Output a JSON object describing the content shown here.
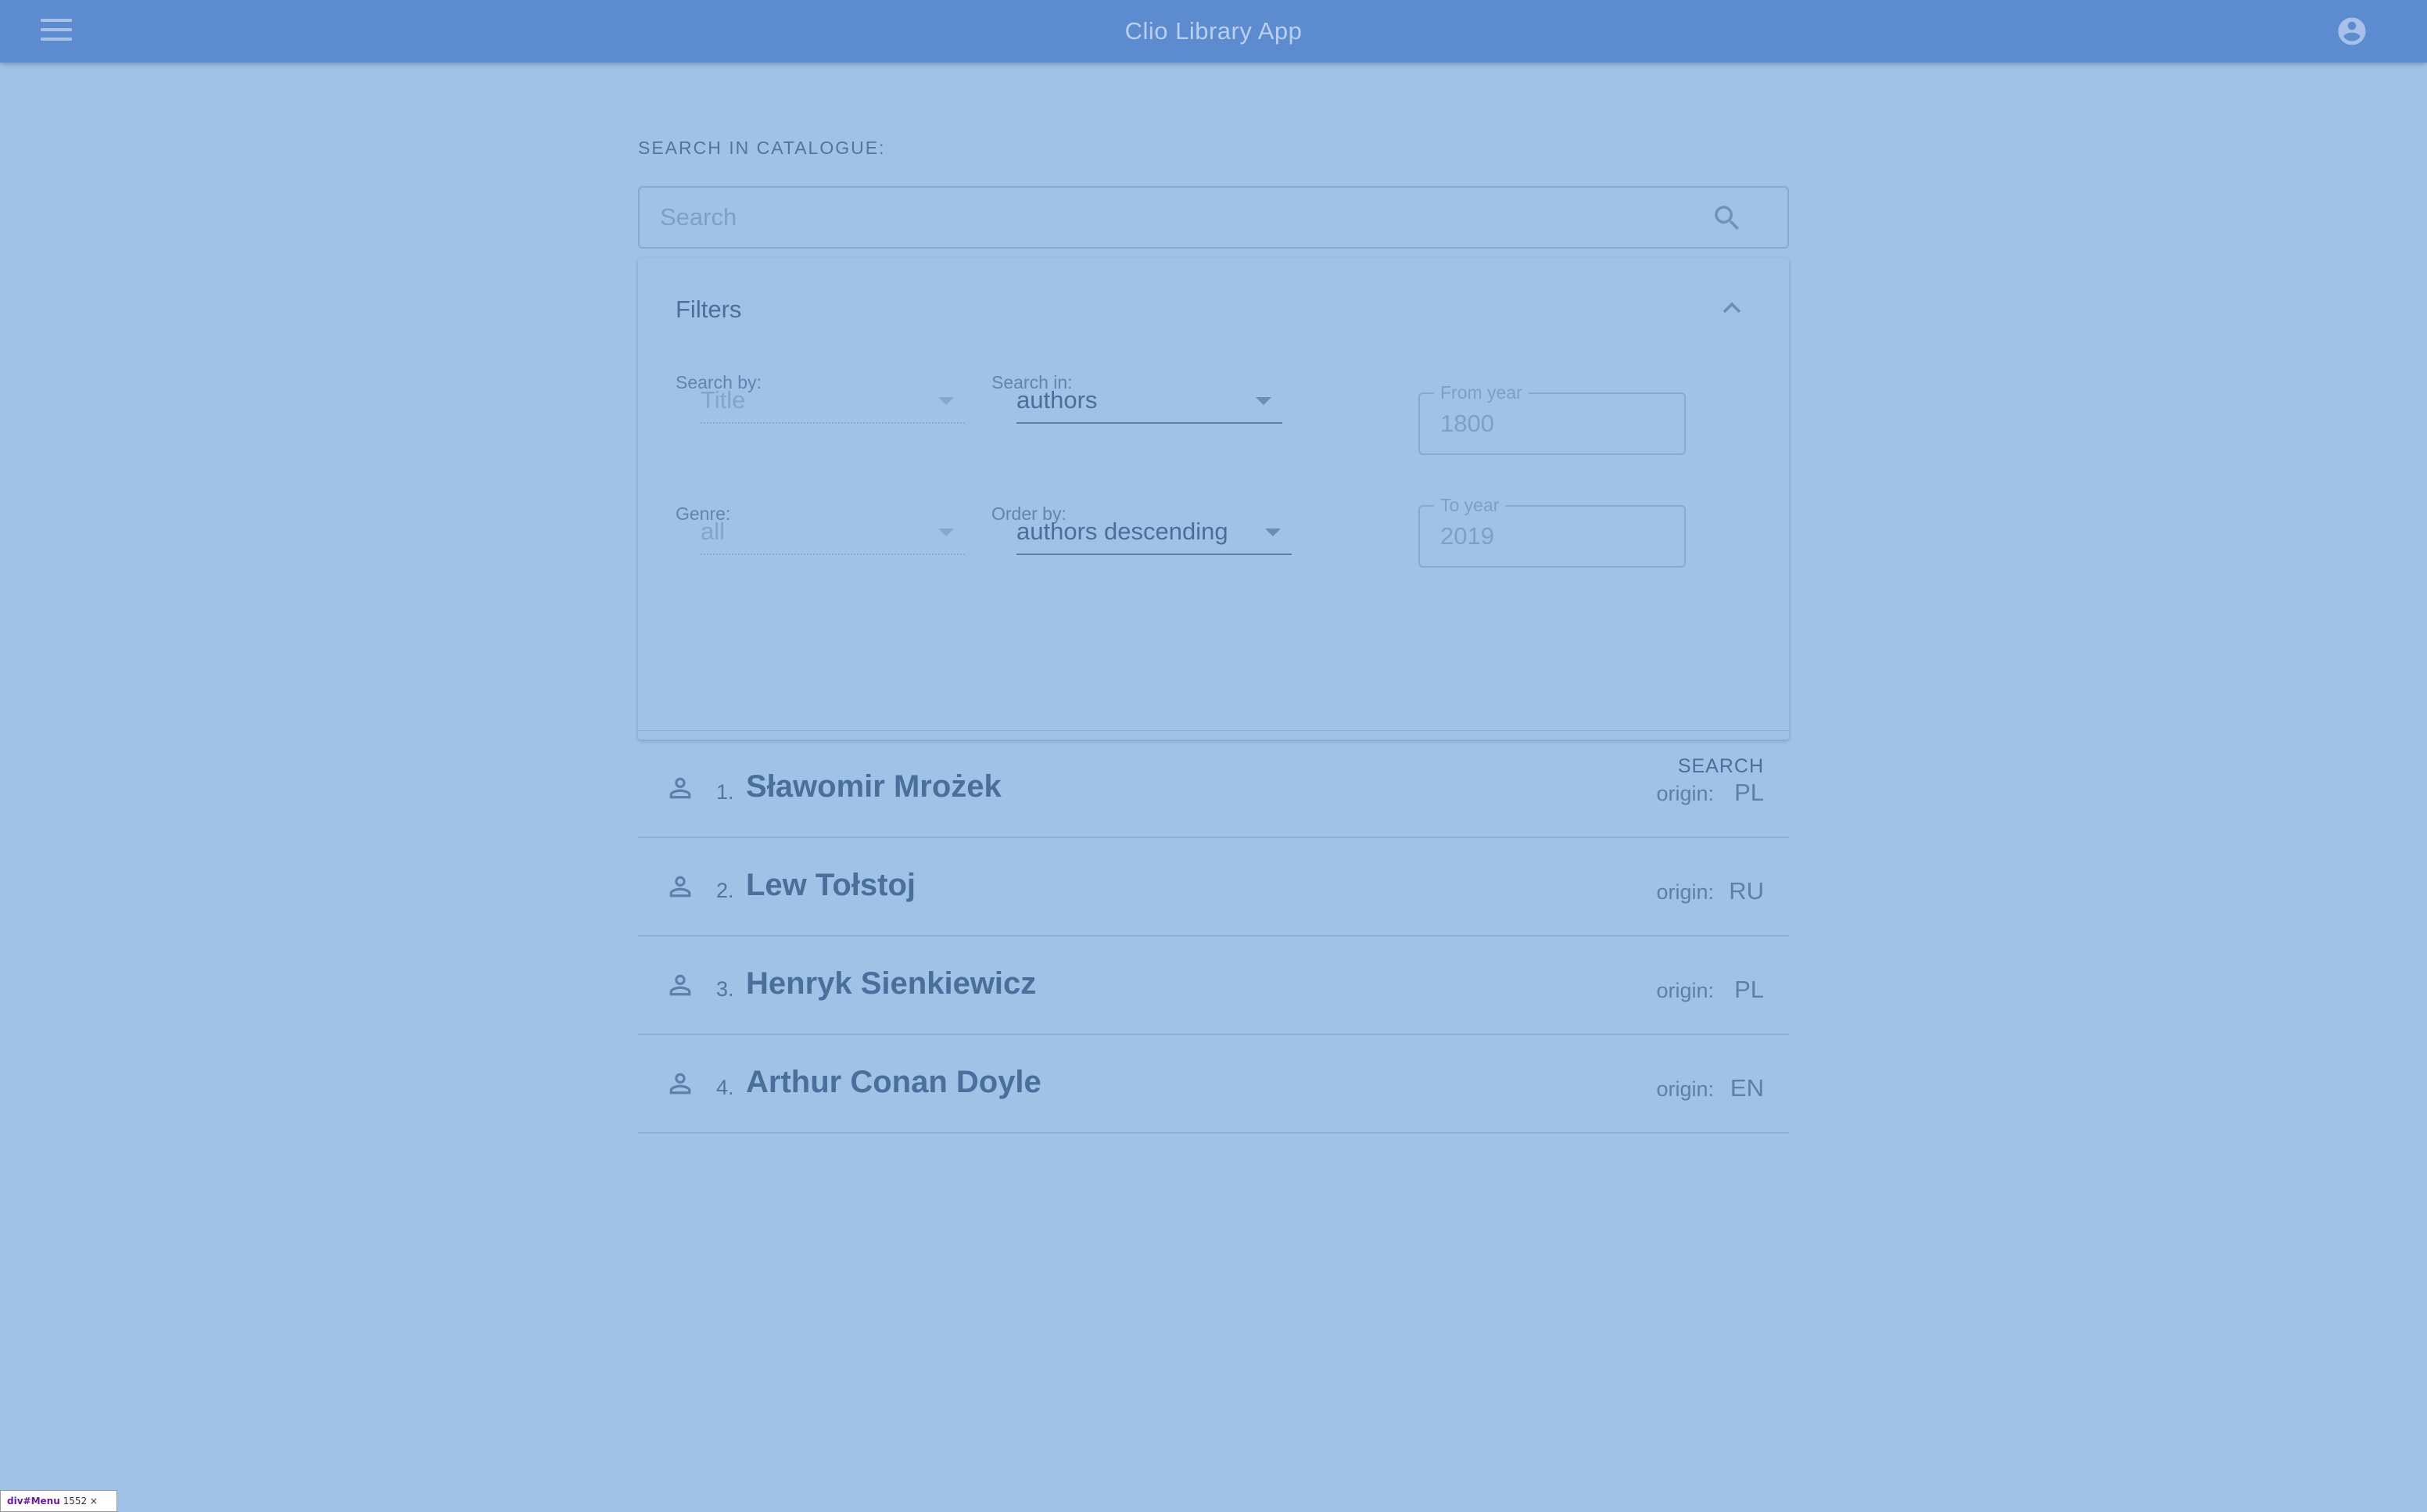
{
  "app": {
    "title": "Clio Library App"
  },
  "search": {
    "heading": "SEARCH IN CATALOGUE:",
    "placeholder": "Search",
    "value": ""
  },
  "filters": {
    "title": "Filters",
    "search_by": {
      "label": "Search by:",
      "value": "Title"
    },
    "search_in": {
      "label": "Search in:",
      "value": "authors"
    },
    "genre": {
      "label": "Genre:",
      "value": "all"
    },
    "order_by": {
      "label": "Order by:",
      "value": "authors descending"
    },
    "from_year": {
      "label": "From year",
      "value": "1800"
    },
    "to_year": {
      "label": "To year",
      "value": "2019"
    },
    "search_button": "SEARCH"
  },
  "results": [
    {
      "num": "1.",
      "name": "Sławomir Mrożek",
      "origin_label": "origin:",
      "origin": "PL"
    },
    {
      "num": "2.",
      "name": "Lew Tołstoj",
      "origin_label": "origin:",
      "origin": "RU"
    },
    {
      "num": "3.",
      "name": "Henryk Sienkiewicz",
      "origin_label": "origin:",
      "origin": "PL"
    },
    {
      "num": "4.",
      "name": "Arthur Conan Doyle",
      "origin_label": "origin:",
      "origin": "EN"
    }
  ],
  "debug": {
    "element": "div#Menu",
    "size": "1552 × 967"
  },
  "colors": {
    "background": "#9fc2e6",
    "topbar": "#5d8bd0",
    "text": "#4a6f9a"
  },
  "icons": {
    "menu": "menu-icon",
    "account": "account-circle-icon",
    "search": "search-icon",
    "collapse": "chevron-up-icon",
    "person": "person-icon"
  }
}
